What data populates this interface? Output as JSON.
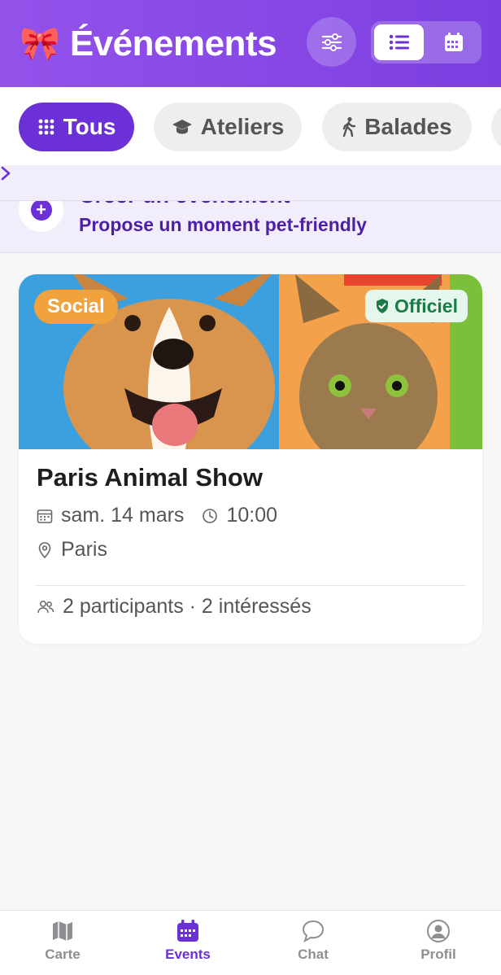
{
  "header": {
    "emoji": "🎀",
    "title": "Événements"
  },
  "chips": [
    {
      "label": "Tous",
      "icon": "grid-icon",
      "active": true
    },
    {
      "label": "Ateliers",
      "icon": "graduation-cap-icon",
      "active": false
    },
    {
      "label": "Balades",
      "icon": "walking-icon",
      "active": false
    }
  ],
  "create": {
    "title": "Créer un événement",
    "subtitle": "Propose un moment pet-friendly",
    "plus": "+"
  },
  "event": {
    "category": "Social",
    "official_label": "Officiel",
    "title": "Paris Animal Show",
    "date": "sam. 14 mars",
    "time": "10:00",
    "location": "Paris",
    "participants": "2 participants · 2 intéressés"
  },
  "nav": [
    {
      "label": "Carte",
      "icon": "map-icon",
      "active": false
    },
    {
      "label": "Events",
      "icon": "calendar-icon",
      "active": true
    },
    {
      "label": "Chat",
      "icon": "chat-icon",
      "active": false
    },
    {
      "label": "Profil",
      "icon": "profile-icon",
      "active": false
    }
  ],
  "colors": {
    "primary": "#6b30d6",
    "header_start": "#9452ea",
    "header_end": "#7b3fe0",
    "social": "#f0a33c",
    "official_bg": "#e5f6ec",
    "official_text": "#1b7b47"
  }
}
